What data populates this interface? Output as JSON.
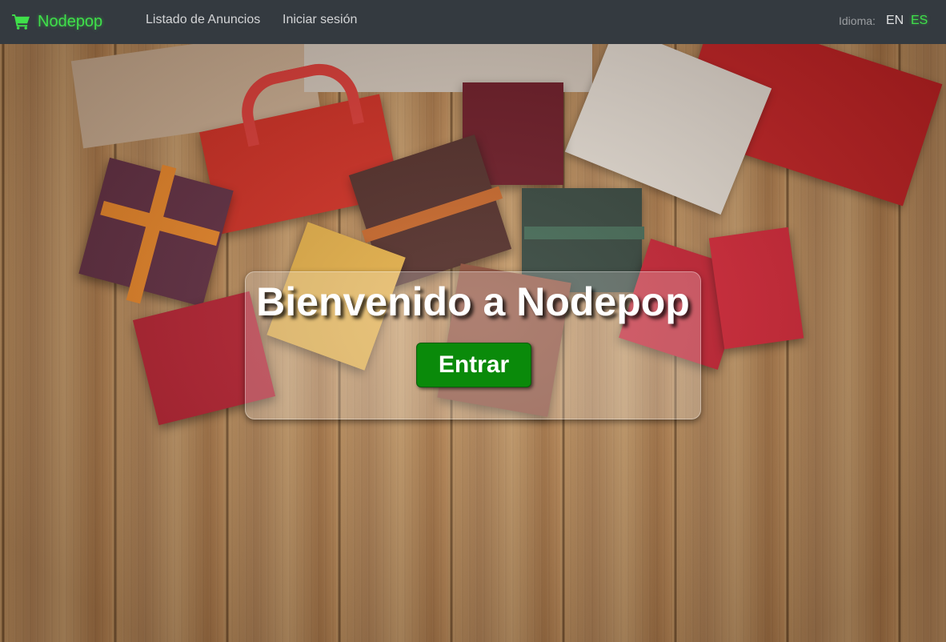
{
  "navbar": {
    "brand": "Nodepop",
    "links": [
      "Listado de Anuncios",
      "Iniciar sesión"
    ],
    "language_label": "Idioma:",
    "languages": [
      "EN",
      "ES"
    ],
    "active_language": "ES"
  },
  "hero": {
    "title": "Bienvenido a Nodepop",
    "button_label": "Entrar"
  },
  "colors": {
    "navbar_bg": "#343a40",
    "brand_green": "#3fe04a",
    "button_green": "#0a8a0a"
  },
  "icons": {
    "brand": "shopping-cart-icon"
  }
}
